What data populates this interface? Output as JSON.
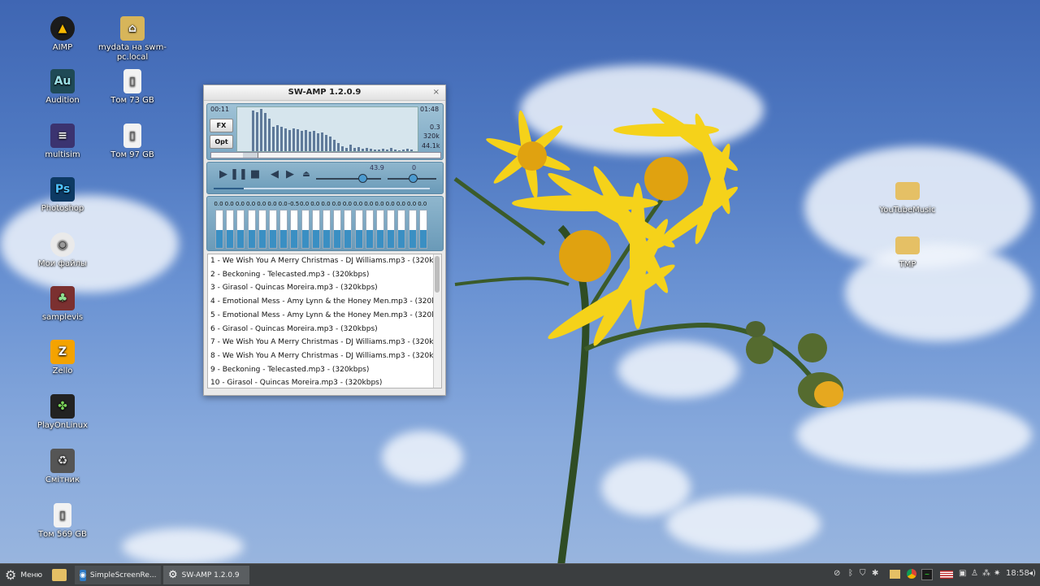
{
  "desktop_icons": [
    {
      "label": "AIMP",
      "icon": "aimp-icon",
      "color": "#1b1b1b",
      "glyph": "▲"
    },
    {
      "label": "Audition",
      "icon": "audition-icon",
      "color": "#1f4a56",
      "glyph": "Au"
    },
    {
      "label": "multisim",
      "icon": "multisim-icon",
      "color": "#3b3370",
      "glyph": "≡"
    },
    {
      "label": "Photoshop",
      "icon": "photoshop-icon",
      "color": "#0d3a64",
      "glyph": "Ps"
    },
    {
      "label": "Мои файлы",
      "icon": "disc-icon",
      "color": "#eaeaea",
      "glyph": "◉"
    },
    {
      "label": "samplevis",
      "icon": "samplevis-icon",
      "color": "#7b3030",
      "glyph": "♣"
    },
    {
      "label": "Zello",
      "icon": "zello-icon",
      "color": "#f4a300",
      "glyph": "Z"
    },
    {
      "label": "PlayOnLinux",
      "icon": "playonlinux-icon",
      "color": "#222",
      "glyph": "✤"
    },
    {
      "label": "Смітник",
      "icon": "trash-icon",
      "color": "#555",
      "glyph": "♻"
    },
    {
      "label": "Том 569 GB",
      "icon": "drive-icon",
      "color": "#f2f2f2",
      "glyph": "▯"
    },
    {
      "label": "mydata на swm-pc.local",
      "icon": "network-folder-icon",
      "color": "#d7b55a",
      "glyph": "⌂"
    },
    {
      "label": "Том 73 GB",
      "icon": "drive-icon",
      "color": "#f2f2f2",
      "glyph": "▯"
    },
    {
      "label": "Том 97 GB",
      "icon": "drive-icon",
      "color": "#f2f2f2",
      "glyph": "▯"
    },
    {
      "label": "YouTubeMusic",
      "icon": "folder-icon",
      "color": "#e5c065",
      "glyph": ""
    },
    {
      "label": "TMP",
      "icon": "folder-icon",
      "color": "#e5c065",
      "glyph": ""
    }
  ],
  "player": {
    "title": "SW-AMP 1.2.0.9",
    "close": "×",
    "elapsed": "00:11",
    "total": "01:48",
    "fx_label": "FX",
    "opt_label": "Opt",
    "info_gain": "0.3",
    "info_bitrate": "320k",
    "info_rate": "44.1k",
    "volume_value": "43.9",
    "balance_value": "0",
    "progress_fraction": 0.14,
    "volume_fraction": 0.7,
    "eq_values": [
      "0.0",
      "0.0",
      "0.0",
      "0.0",
      "0.0",
      "0.0",
      "0.0",
      "-0.5",
      "0.0",
      "0.0",
      "0.0",
      "0.0",
      "0.0",
      "0.0",
      "0.0",
      "0.0",
      "0.0",
      "0.0",
      "0.0",
      "0.0"
    ],
    "playlist": [
      "1 - We Wish You A Merry Christmas - DJ Williams.mp3 - (320kbp",
      "2 - Beckoning - Telecasted.mp3 - (320kbps)",
      "3 - Girasol - Quincas Moreira.mp3 - (320kbps)",
      "4 - Emotional Mess - Amy Lynn & the Honey Men.mp3 - (320kbp",
      "5 - Emotional Mess - Amy Lynn & the Honey Men.mp3 - (320kbp",
      "6 - Girasol - Quincas Moreira.mp3 - (320kbps)",
      "7 - We Wish You A Merry Christmas - DJ Williams.mp3 - (320kbp",
      "8 - We Wish You A Merry Christmas - DJ Williams.mp3 - (320kbp",
      "9 - Beckoning - Telecasted.mp3 - (320kbps)",
      "10 - Girasol - Quincas Moreira.mp3 - (320kbps)"
    ]
  },
  "taskbar": {
    "menu_label": "Меню",
    "windows": [
      {
        "label": "SimpleScreenRe...",
        "icon": "camera-icon"
      },
      {
        "label": "SW-AMP 1.2.0.9",
        "icon": "gear-icon"
      }
    ],
    "clock": "18:58"
  }
}
